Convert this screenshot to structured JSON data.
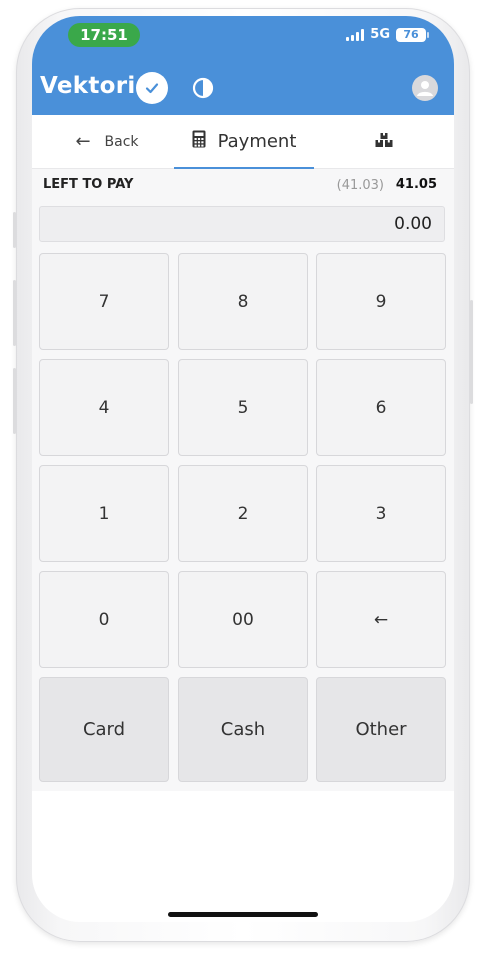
{
  "status_bar": {
    "time": "17:51",
    "network": "5G",
    "battery": "76"
  },
  "header": {
    "brand": "Vektori",
    "icons": [
      "check-icon",
      "contrast-icon",
      "avatar-icon"
    ],
    "background_color": "#4a90d9"
  },
  "tabs": {
    "back_label": "Back",
    "payment_label": "Payment",
    "active": "Payment"
  },
  "payment": {
    "left_to_pay_label": "LEFT TO PAY",
    "previous_amount": "(41.03)",
    "amount_due": "41.05",
    "entered_amount": "0.00"
  },
  "keypad": {
    "k7": "7",
    "k8": "8",
    "k9": "9",
    "k4": "4",
    "k5": "5",
    "k6": "6",
    "k1": "1",
    "k2": "2",
    "k3": "3",
    "k0": "0",
    "k00": "00",
    "backspace": "←"
  },
  "payment_methods": {
    "card": "Card",
    "cash": "Cash",
    "other": "Other"
  }
}
